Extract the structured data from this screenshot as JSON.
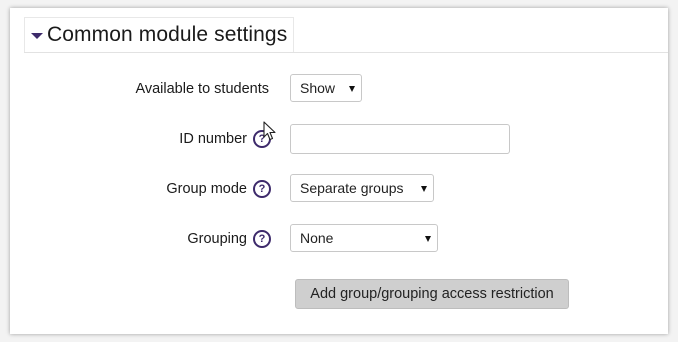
{
  "section": {
    "title": "Common module settings"
  },
  "fields": {
    "visible": {
      "label": "Available to students",
      "value": "Show"
    },
    "idnumber": {
      "label": "ID number",
      "help": "?",
      "value": ""
    },
    "groupmode": {
      "label": "Group mode",
      "help": "?",
      "value": "Separate groups"
    },
    "grouping": {
      "label": "Grouping",
      "help": "?",
      "value": "None"
    }
  },
  "actions": {
    "restriction_button": "Add group/grouping access restriction"
  },
  "icons": {
    "collapse": "caret-down-icon",
    "help": "question-circle-icon",
    "cursor": "mouse-pointer-icon",
    "dropdown": "dropdown-arrow-icon"
  },
  "colors": {
    "accent": "#3d2a6b",
    "button_bg": "#cfcfcf",
    "page_bg": "#f3f3f3"
  }
}
